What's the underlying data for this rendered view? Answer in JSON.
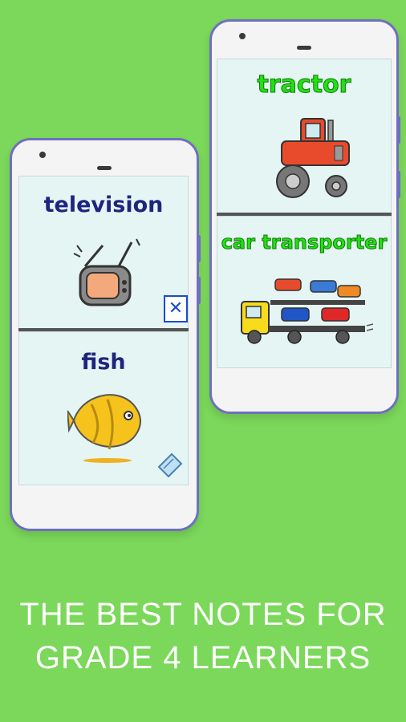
{
  "left_phone": {
    "card1": {
      "word": "television",
      "icon": "television-icon",
      "badge": "✕"
    },
    "card2": {
      "word": "fish",
      "icon": "fish-icon",
      "corner_icon": "note-icon"
    }
  },
  "right_phone": {
    "card1": {
      "word": "tractor",
      "icon": "tractor-icon"
    },
    "card2": {
      "word": "car transporter",
      "icon": "car-transporter-icon"
    }
  },
  "footer": {
    "line1": "THE BEST NOTES FOR",
    "line2": "GRADE 4 LEARNERS"
  },
  "colors": {
    "background": "#7bd85a",
    "phone_border": "#6f6fc0",
    "word_blue": "#1f2480",
    "word_green": "#22e014"
  }
}
